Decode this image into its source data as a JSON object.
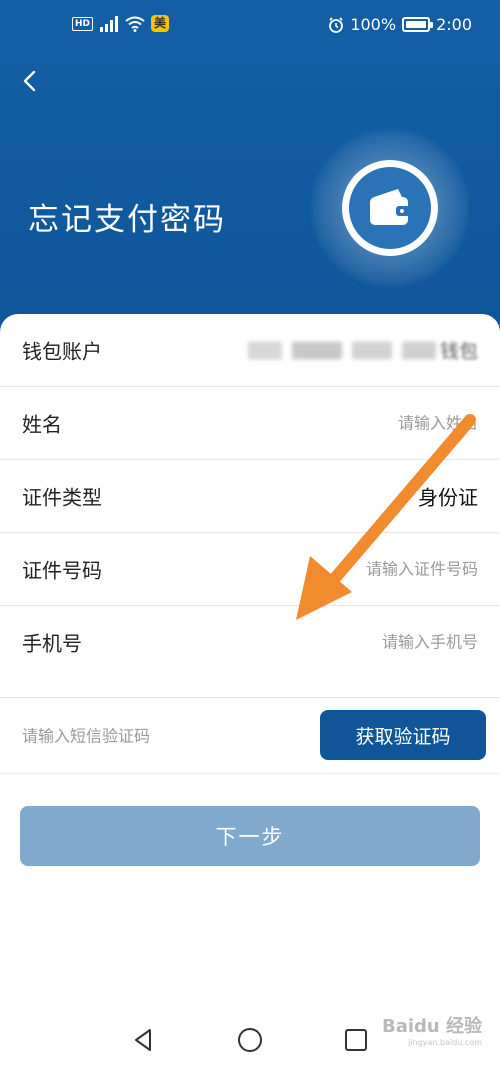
{
  "statusbar": {
    "network_badge": "HD",
    "app_badge": "美",
    "battery": "100%",
    "time": "2:00"
  },
  "header": {
    "title": "忘记支付密码"
  },
  "form": {
    "rows": [
      {
        "label": "钱包账户",
        "value": "钱包"
      },
      {
        "label": "姓名",
        "placeholder": "请输入姓名"
      },
      {
        "label": "证件类型",
        "value": "身份证"
      },
      {
        "label": "证件号码",
        "placeholder": "请输入证件号码"
      },
      {
        "label": "手机号",
        "placeholder": "请输入手机号"
      }
    ],
    "sms_code": {
      "placeholder": "请输入短信验证码",
      "button_label": "获取验证码"
    },
    "next_label": "下一步"
  },
  "watermark": {
    "brand": "Baidu 经验",
    "url": "jingyan.baidu.com"
  },
  "colors": {
    "header_blue": "#135ea4",
    "button_blue": "#0f5598",
    "disabled_button": "#80a9cd",
    "annotation_arrow": "#f28a2e"
  }
}
